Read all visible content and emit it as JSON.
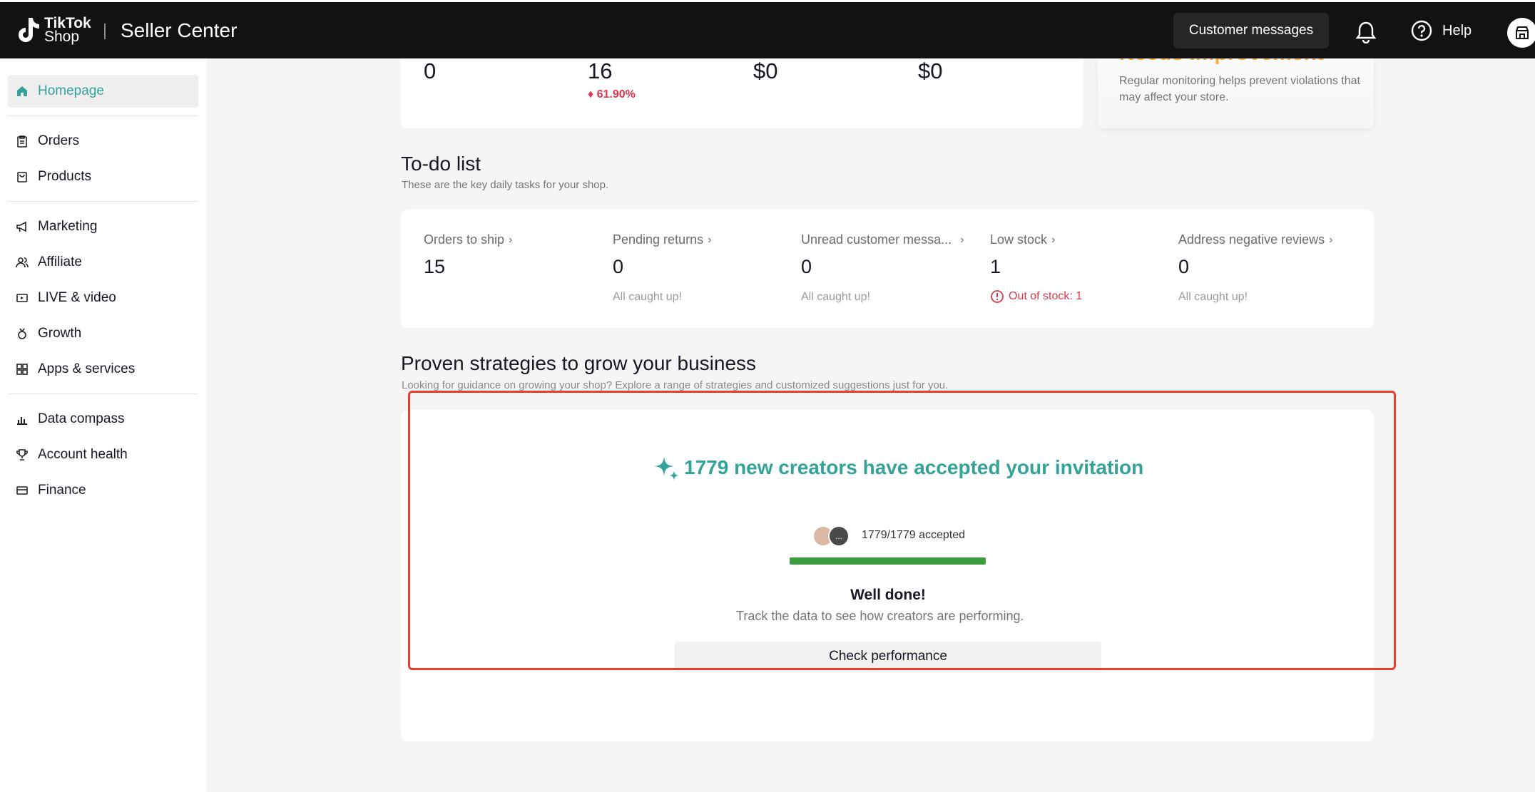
{
  "header": {
    "logo_line1": "TikTok",
    "logo_line2": "Shop",
    "brand": "Seller Center",
    "customer_messages": "Customer messages",
    "help": "Help"
  },
  "sidebar": {
    "items": [
      {
        "label": "Homepage",
        "icon": "home-icon"
      },
      {
        "label": "Orders",
        "icon": "clipboard-icon"
      },
      {
        "label": "Products",
        "icon": "bag-icon"
      },
      {
        "label": "Marketing",
        "icon": "megaphone-icon"
      },
      {
        "label": "Affiliate",
        "icon": "people-icon"
      },
      {
        "label": "LIVE & video",
        "icon": "video-icon"
      },
      {
        "label": "Growth",
        "icon": "medal-icon"
      },
      {
        "label": "Apps & services",
        "icon": "apps-icon"
      },
      {
        "label": "Data compass",
        "icon": "bar-chart-icon"
      },
      {
        "label": "Account health",
        "icon": "trophy-icon"
      },
      {
        "label": "Finance",
        "icon": "card-icon"
      }
    ]
  },
  "kpis": {
    "v1": "0",
    "v2": "16",
    "v2_change": "61.90%",
    "v3": "$0",
    "v4": "$0"
  },
  "health": {
    "title": "Needs improvement",
    "desc": "Regular monitoring helps prevent violations that may affect your store."
  },
  "todo": {
    "title": "To-do list",
    "subtitle": "These are the key daily tasks for your shop.",
    "items": [
      {
        "label": "Orders to ship",
        "value": "15",
        "note": ""
      },
      {
        "label": "Pending returns",
        "value": "0",
        "note": "All caught up!"
      },
      {
        "label": "Unread customer messa...",
        "value": "0",
        "note": "All caught up!"
      },
      {
        "label": "Low stock",
        "value": "1",
        "note": "Out of stock: 1"
      },
      {
        "label": "Address negative reviews",
        "value": "0",
        "note": "All caught up!"
      }
    ]
  },
  "strategies": {
    "title": "Proven strategies to grow your business",
    "subtitle": "Looking for guidance on growing your shop? Explore a range of strategies and customized suggestions just for you.",
    "headline": "1779 new creators have accepted your invitation",
    "accepted": "1779/1779 accepted",
    "progress": 1.0,
    "avatar_more": "...",
    "well_done": "Well done!",
    "track": "Track the data to see how creators are performing.",
    "button": "Check performance"
  },
  "colors": {
    "accent": "#33a39a",
    "negative": "#e0344a",
    "progress": "#3c9d3f",
    "highlight": "#e5402e"
  }
}
